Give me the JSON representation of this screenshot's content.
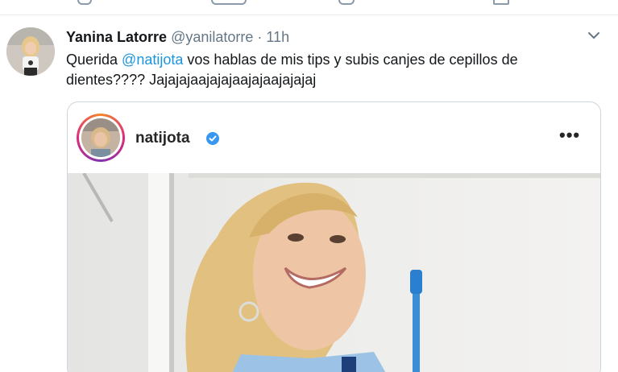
{
  "tweet": {
    "author_name": "Yanina Latorre",
    "author_handle": "@yanilatorre",
    "separator": "·",
    "time": "11h",
    "text_prefix": "Querida ",
    "mention": "@natijota",
    "text_suffix": " vos hablas de mis tips y subis canjes de cepillos de dientes???? Jajajajaajajajaajajaajajajaj"
  },
  "embed": {
    "username": "natijota",
    "more_label": "•••"
  },
  "colors": {
    "mention": "#1b95e0",
    "secondary_text": "#657786",
    "verified": "#3897f0",
    "border": "#ccd6dd"
  },
  "icons": {
    "caret": "chevron-down-icon",
    "verified": "verified-badge-icon",
    "more": "more-options-icon"
  }
}
